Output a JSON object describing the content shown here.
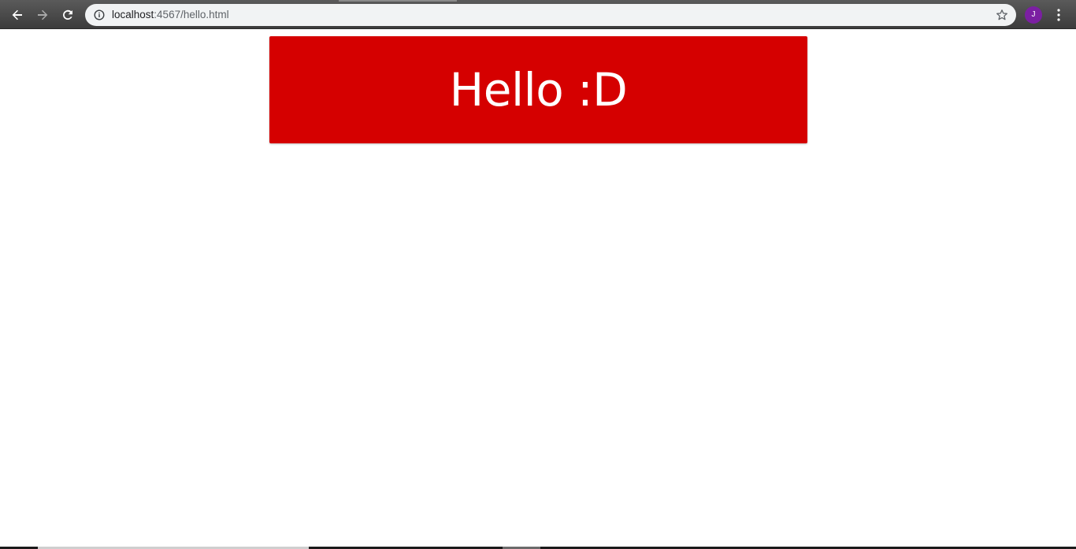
{
  "browser": {
    "url_host": "localhost",
    "url_rest": ":4567/hello.html",
    "profile_initial": "J",
    "profile_color": "#7b1fa2",
    "icons": {
      "back": "back-arrow-icon",
      "forward": "forward-arrow-icon",
      "reload": "reload-icon",
      "site_info": "info-icon",
      "bookmark": "star-icon",
      "menu": "vertical-dots-icon"
    }
  },
  "page": {
    "banner_text": "Hello :D",
    "banner_color": "#d50000",
    "text_color": "#ffffff",
    "background": "#ffffff"
  }
}
